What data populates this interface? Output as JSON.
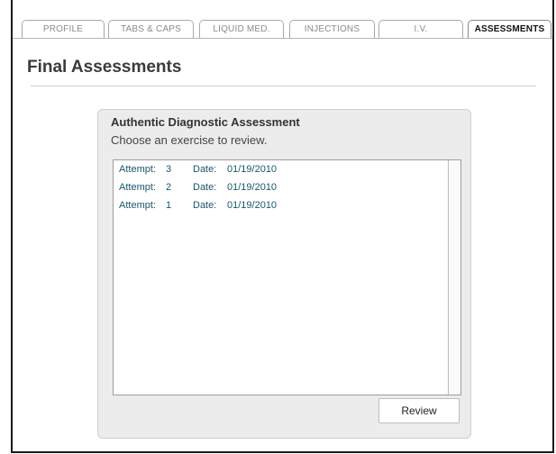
{
  "tabs": [
    {
      "label": "PROFILE",
      "active": false
    },
    {
      "label": "TABS & CAPS",
      "active": false
    },
    {
      "label": "LIQUID MED.",
      "active": false
    },
    {
      "label": "INJECTIONS",
      "active": false
    },
    {
      "label": "I.V.",
      "active": false
    },
    {
      "label": "ASSESSMENTS",
      "active": true
    }
  ],
  "page": {
    "title": "Final Assessments"
  },
  "panel": {
    "title": "Authentic Diagnostic Assessment",
    "subtitle": "Choose an exercise to review.",
    "attempt_label": "Attempt:",
    "date_label": "Date:",
    "attempts": [
      {
        "attempt": "3",
        "date": "01/19/2010"
      },
      {
        "attempt": "2",
        "date": "01/19/2010"
      },
      {
        "attempt": "1",
        "date": "01/19/2010"
      }
    ],
    "review_label": "Review"
  },
  "colors": {
    "row_text": "#16586a",
    "panel_bg": "#ececec"
  }
}
